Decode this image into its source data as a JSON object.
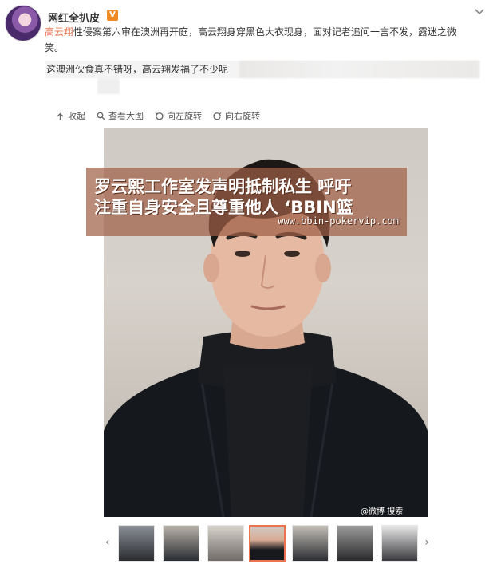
{
  "post": {
    "username": "网红全扒皮",
    "verified_label": "V",
    "link_text": "高云翔",
    "body_rest": "性侵案第六审在澳洲再开庭，高云翔身穿黑色大衣现身，面对记者追问一言不发，露迷之微笑。"
  },
  "comment": {
    "text": "这澳洲伙食真不错呀，高云翔发福了不少呢"
  },
  "toolbar": {
    "collapse_label": "收起",
    "view_large_label": "查看大图",
    "rotate_left_label": "向左旋转",
    "rotate_right_label": "向右旋转"
  },
  "overlay": {
    "line1": "罗云熙工作室发声明抵制私生 呼吁",
    "line2": "注重自身安全且尊重他人 ‘BBIN篮",
    "url": "www.bbin-pokervip.com"
  },
  "photo": {
    "credit": "@微博 搜索"
  },
  "thumbnails": {
    "count": 7,
    "selected_index": 3
  },
  "colors": {
    "link": "#eb7350",
    "verified": "#f08a24",
    "banner": "#a06046"
  }
}
